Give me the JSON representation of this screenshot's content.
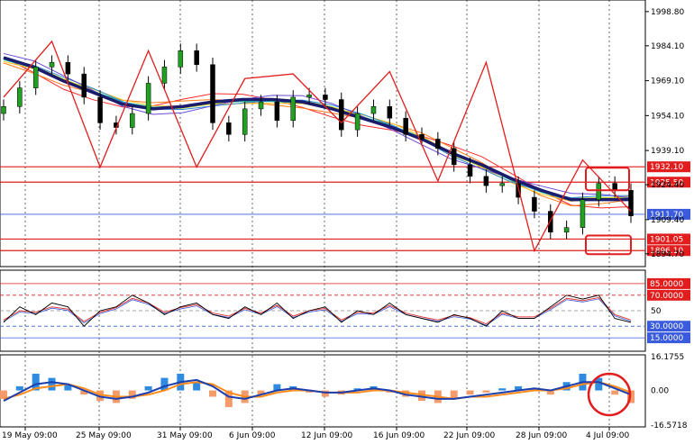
{
  "chart_data": {
    "type": "line",
    "colors": {
      "hline_red": "#e11d1d",
      "hline_blue": "#3a5bdc",
      "ma_thick": "#1c1c6e",
      "zigzag": "#e11d1d",
      "stoch_black": "#000000",
      "stoch_blue": "#3a5bdc",
      "stoch_red": "#e33b3b",
      "hist_pos": "#2f8be0",
      "hist_neg": "#f39b6b",
      "macd_main": "#1c3fb0",
      "macd_signal": "#ff8c1a",
      "annotation": "#e11d1d"
    },
    "x_tick_labels": [
      "19 May 09:00",
      "25 May 09:00",
      "31 May 09:00",
      "6 Jun 09:00",
      "12 Jun 09:00",
      "16 Jun 09:00",
      "22 Jun 09:00",
      "28 Jun 09:00",
      "4 Jul 09:00"
    ],
    "price_panel": {
      "ylim": [
        1890.0,
        2003.0
      ],
      "y_tick_labels": [
        "1998.80",
        "1984.10",
        "1969.10",
        "1954.10",
        "1939.10",
        "1924.40",
        "1909.40",
        "1894.70"
      ],
      "hlines": [
        {
          "label": "1932.10",
          "value": 1932.1,
          "color": "red",
          "highlight": true
        },
        {
          "label": "1925.50",
          "value": 1925.5,
          "color": "red",
          "highlight": true
        },
        {
          "label": "1911.70",
          "value": 1911.7,
          "color": "blue",
          "highlight": false
        },
        {
          "label": "1901.05",
          "value": 1901.05,
          "color": "red",
          "highlight": true
        },
        {
          "label": "1896.10",
          "value": 1896.1,
          "color": "red",
          "highlight": true
        }
      ],
      "zigzag_values": [
        1962,
        1986,
        1932,
        1982,
        1932,
        1970,
        1972,
        1951,
        1973,
        1926,
        1977,
        1896,
        1935,
        1913
      ],
      "ma_values": [
        1979,
        1975,
        1969,
        1964,
        1959,
        1957,
        1958,
        1960,
        1961,
        1961,
        1960,
        1957,
        1953,
        1949,
        1944,
        1938,
        1933,
        1927,
        1922,
        1918,
        1918,
        1918
      ],
      "close_values": [
        1958,
        1966,
        1975,
        1977,
        1972,
        1962,
        1951,
        1949,
        1955,
        1968,
        1975,
        1982,
        1976,
        1951,
        1946,
        1957,
        1960,
        1952,
        1962,
        1963,
        1961,
        1948,
        1955,
        1958,
        1953,
        1946,
        1944,
        1940,
        1933,
        1928,
        1924,
        1925,
        1919,
        1913,
        1904,
        1906,
        1918,
        1925,
        1922,
        1911
      ]
    },
    "stoch_panel": {
      "ylim": [
        0,
        100
      ],
      "y_tick_labels": [
        "85.0000",
        "70.0000",
        "50",
        "30.0000",
        "15.0000"
      ],
      "levels": [
        85,
        70,
        50,
        30,
        15
      ],
      "k_values": [
        35,
        55,
        45,
        60,
        55,
        30,
        50,
        55,
        70,
        60,
        45,
        55,
        60,
        45,
        40,
        55,
        45,
        60,
        40,
        50,
        55,
        35,
        50,
        45,
        60,
        45,
        40,
        35,
        45,
        40,
        30,
        50,
        40,
        40,
        55,
        70,
        65,
        70,
        40,
        35
      ],
      "d_values": [
        38,
        50,
        48,
        55,
        52,
        36,
        48,
        54,
        66,
        60,
        48,
        54,
        58,
        47,
        43,
        53,
        47,
        57,
        43,
        50,
        53,
        38,
        48,
        47,
        57,
        47,
        42,
        38,
        44,
        41,
        33,
        47,
        42,
        42,
        53,
        66,
        63,
        67,
        45,
        38
      ]
    },
    "macd_panel": {
      "ylim": [
        -16.5718,
        16.1755
      ],
      "y_tick_labels": [
        "16.1755",
        "0.00",
        "-16.5718"
      ],
      "histogram": [
        -4,
        2,
        8,
        6,
        3,
        -2,
        -5,
        -6,
        -4,
        2,
        6,
        8,
        4,
        -3,
        -8,
        -6,
        -2,
        3,
        2,
        -1,
        -3,
        -2,
        1,
        2,
        -1,
        -3,
        -5,
        -6,
        -4,
        -2,
        -1,
        1,
        2,
        1,
        -2,
        4,
        8,
        6,
        -2,
        -6
      ],
      "main_values": [
        -5,
        -1,
        3,
        4,
        3,
        0,
        -3,
        -4,
        -3,
        -1,
        2,
        4,
        5,
        2,
        -3,
        -4,
        -2,
        0,
        1,
        0,
        -1,
        -1,
        0,
        1,
        0,
        -2,
        -3,
        -4,
        -4,
        -3,
        -2,
        -1,
        0,
        1,
        0,
        2,
        4,
        4,
        1,
        -2
      ],
      "signal_values": [
        -4,
        -2,
        1,
        2,
        3,
        1,
        -2,
        -3,
        -3,
        -2,
        0,
        3,
        4,
        3,
        -1,
        -3,
        -3,
        -1,
        0,
        0,
        -1,
        -1,
        -1,
        0,
        0,
        -1,
        -2,
        -3,
        -4,
        -3,
        -3,
        -2,
        -1,
        0,
        0,
        1,
        3,
        4,
        2,
        -1
      ]
    }
  },
  "price_tags": {
    "t1": "1932.10",
    "t2": "1925.50",
    "t3": "1911.70",
    "t4": "1901.05",
    "t5": "1896.10"
  }
}
